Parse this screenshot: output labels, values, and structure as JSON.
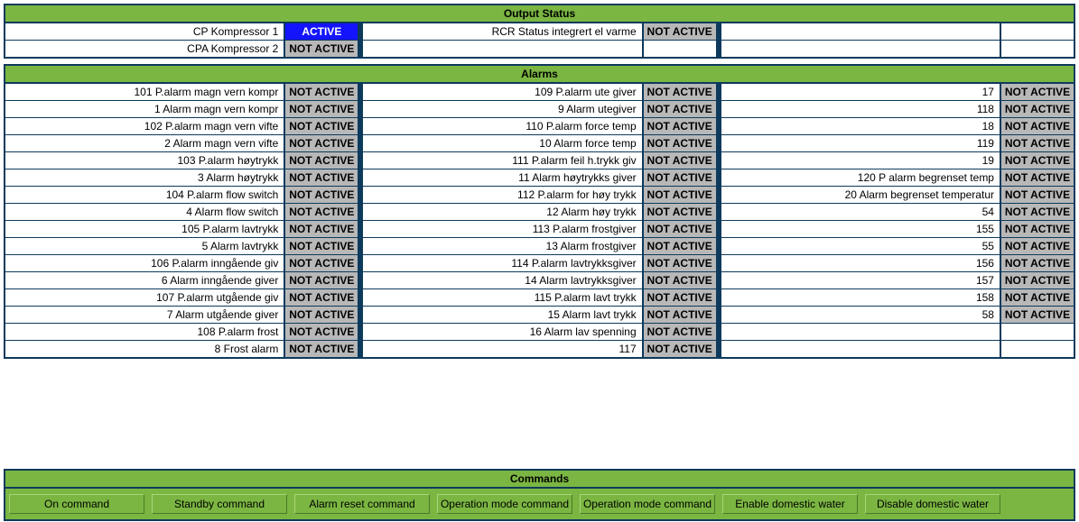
{
  "output_status": {
    "title": "Output Status",
    "rows": [
      [
        {
          "label": "CP Kompressor 1",
          "status": "ACTIVE"
        },
        {
          "label": "RCR Status integrert el varme",
          "status": "NOT ACTIVE"
        },
        {
          "label": "",
          "status": ""
        }
      ],
      [
        {
          "label": "CPA Kompressor 2",
          "status": "NOT ACTIVE"
        },
        {
          "label": "",
          "status": ""
        },
        {
          "label": "",
          "status": ""
        }
      ]
    ]
  },
  "alarms": {
    "title": "Alarms",
    "rows": [
      [
        {
          "label": "101 P.alarm magn vern kompr",
          "status": "NOT ACTIVE"
        },
        {
          "label": "109 P.alarm ute giver",
          "status": "NOT ACTIVE"
        },
        {
          "label": "17",
          "status": "NOT ACTIVE"
        }
      ],
      [
        {
          "label": "1 Alarm magn vern kompr",
          "status": "NOT ACTIVE"
        },
        {
          "label": "9 Alarm utegiver",
          "status": "NOT ACTIVE"
        },
        {
          "label": "118",
          "status": "NOT ACTIVE"
        }
      ],
      [
        {
          "label": "102 P.alarm magn vern vifte",
          "status": "NOT ACTIVE"
        },
        {
          "label": "110 P.alarm force temp",
          "status": "NOT ACTIVE"
        },
        {
          "label": "18",
          "status": "NOT ACTIVE"
        }
      ],
      [
        {
          "label": "2 Alarm magn vern vifte",
          "status": "NOT ACTIVE"
        },
        {
          "label": "10 Alarm force temp",
          "status": "NOT ACTIVE"
        },
        {
          "label": "119",
          "status": "NOT ACTIVE"
        }
      ],
      [
        {
          "label": "103 P.alarm høytrykk",
          "status": "NOT ACTIVE"
        },
        {
          "label": "111 P.alarm feil h.trykk giv",
          "status": "NOT ACTIVE"
        },
        {
          "label": "19",
          "status": "NOT ACTIVE"
        }
      ],
      [
        {
          "label": "3 Alarm høytrykk",
          "status": "NOT ACTIVE"
        },
        {
          "label": "11 Alarm høytrykks giver",
          "status": "NOT ACTIVE"
        },
        {
          "label": "120 P alarm begrenset temp",
          "status": "NOT ACTIVE"
        }
      ],
      [
        {
          "label": "104 P.alarm flow switch",
          "status": "NOT ACTIVE"
        },
        {
          "label": "112 P.alarm for høy trykk",
          "status": "NOT ACTIVE"
        },
        {
          "label": "20 Alarm begrenset temperatur",
          "status": "NOT ACTIVE"
        }
      ],
      [
        {
          "label": "4 Alarm flow switch",
          "status": "NOT ACTIVE"
        },
        {
          "label": "12 Alarm høy trykk",
          "status": "NOT ACTIVE"
        },
        {
          "label": "54",
          "status": "NOT ACTIVE"
        }
      ],
      [
        {
          "label": "105 P.alarm lavtrykk",
          "status": "NOT ACTIVE"
        },
        {
          "label": "113 P.alarm frostgiver",
          "status": "NOT ACTIVE"
        },
        {
          "label": "155",
          "status": "NOT ACTIVE"
        }
      ],
      [
        {
          "label": "5 Alarm lavtrykk",
          "status": "NOT ACTIVE"
        },
        {
          "label": "13 Alarm frostgiver",
          "status": "NOT ACTIVE"
        },
        {
          "label": "55",
          "status": "NOT ACTIVE"
        }
      ],
      [
        {
          "label": "106 P.alarm inngående giv",
          "status": "NOT ACTIVE"
        },
        {
          "label": "114 P.alarm lavtrykksgiver",
          "status": "NOT ACTIVE"
        },
        {
          "label": "156",
          "status": "NOT ACTIVE"
        }
      ],
      [
        {
          "label": "6 Alarm inngående giver",
          "status": "NOT ACTIVE"
        },
        {
          "label": "14 Alarm lavtrykksgiver",
          "status": "NOT ACTIVE"
        },
        {
          "label": "157",
          "status": "NOT ACTIVE"
        }
      ],
      [
        {
          "label": "107 P.alarm utgående giv",
          "status": "NOT ACTIVE"
        },
        {
          "label": "115 P.alarm lavt trykk",
          "status": "NOT ACTIVE"
        },
        {
          "label": "158",
          "status": "NOT ACTIVE"
        }
      ],
      [
        {
          "label": "7 Alarm utgående giver",
          "status": "NOT ACTIVE"
        },
        {
          "label": "15 Alarm lavt trykk",
          "status": "NOT ACTIVE"
        },
        {
          "label": "58",
          "status": "NOT ACTIVE"
        }
      ],
      [
        {
          "label": "108 P.alarm frost",
          "status": "NOT ACTIVE"
        },
        {
          "label": "16 Alarm lav spenning",
          "status": "NOT ACTIVE"
        },
        {
          "label": "",
          "status": ""
        }
      ],
      [
        {
          "label": "8 Frost alarm",
          "status": "NOT ACTIVE"
        },
        {
          "label": "117",
          "status": "NOT ACTIVE"
        },
        {
          "label": "",
          "status": ""
        }
      ]
    ]
  },
  "commands": {
    "title": "Commands",
    "buttons": [
      "On command",
      "Standby command",
      "Alarm reset command",
      "Operation mode command",
      "Operation mode command",
      "Enable domestic water",
      "Disable domestic water"
    ]
  }
}
